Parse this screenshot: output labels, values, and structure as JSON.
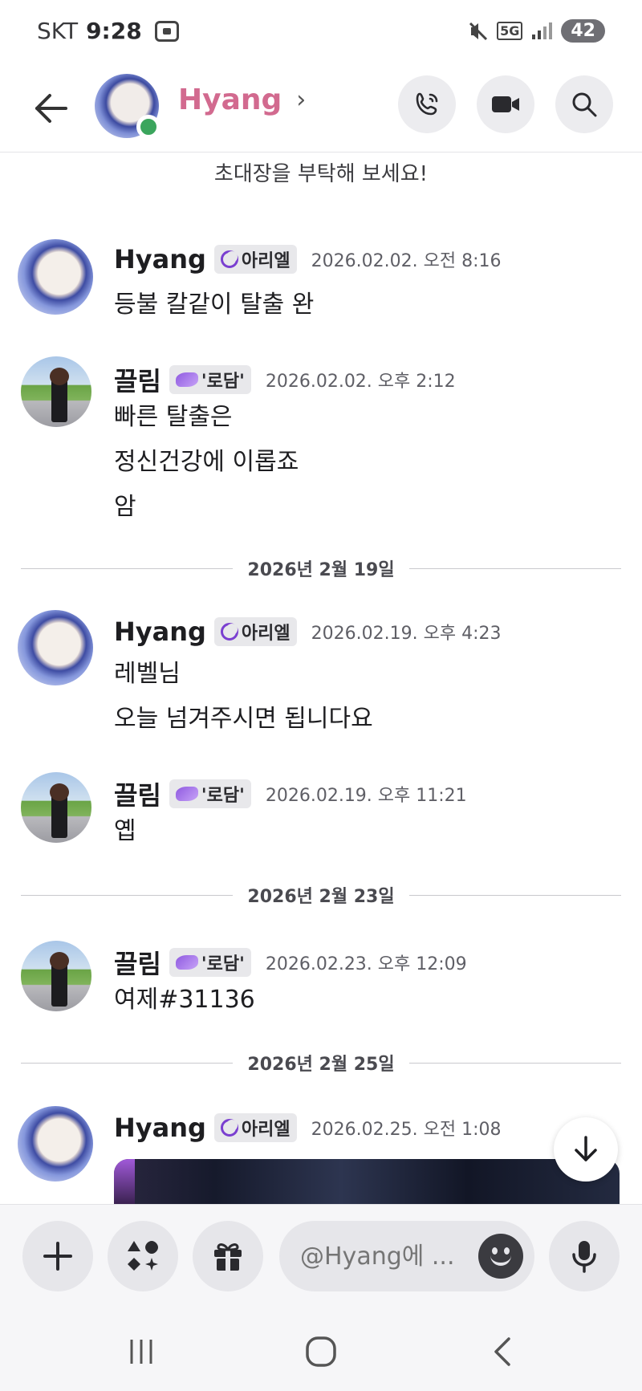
{
  "status_bar": {
    "carrier": "SKT",
    "time": "9:28",
    "network": "5G",
    "battery": "42"
  },
  "header": {
    "name": "Hyang",
    "chevron": "›"
  },
  "invite_text": "초대장을 부탁해 보세요!",
  "tags": {
    "hyang": "아리엘",
    "ggeulim": "'로담'"
  },
  "messages": [
    {
      "user": "Hyang",
      "timestamp": "2026.02.02. 오전 8:16",
      "lines": [
        "등불 칼같이 탈출 완"
      ]
    },
    {
      "user": "끌림",
      "timestamp": "2026.02.02. 오후 2:12",
      "lines": [
        "빠른 탈출은",
        "정신건강에 이롭죠",
        "암"
      ]
    },
    {
      "user": "Hyang",
      "timestamp": "2026.02.19. 오후 4:23",
      "lines": [
        "레벨님",
        "오늘 넘겨주시면 됩니다요"
      ]
    },
    {
      "user": "끌림",
      "timestamp": "2026.02.19. 오후 11:21",
      "lines": [
        "옙"
      ]
    },
    {
      "user": "끌림",
      "timestamp": "2026.02.23. 오후 12:09",
      "lines": [
        "여제#31136"
      ]
    },
    {
      "user": "Hyang",
      "timestamp": "2026.02.25. 오전 1:08",
      "lines": []
    }
  ],
  "dividers": [
    "2026년 2월 19일",
    "2026년 2월 23일",
    "2026년 2월 25일"
  ],
  "input": {
    "placeholder": "@Hyang에 ..."
  },
  "colors": {
    "accent_name": "#d26a8f",
    "online": "#3ba55d",
    "tag_purple": "#7a3fd0"
  }
}
